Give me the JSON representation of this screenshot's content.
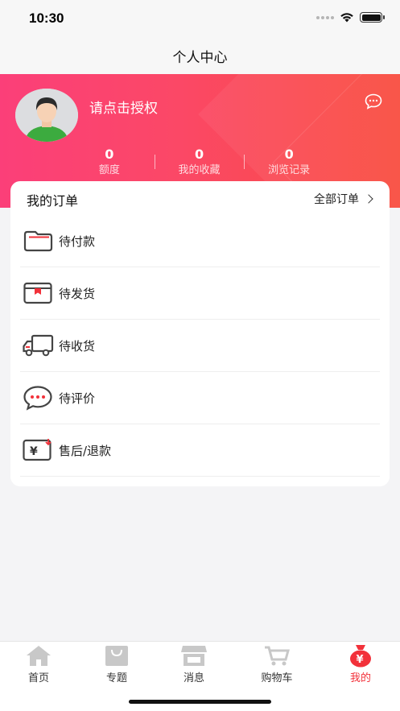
{
  "status_bar": {
    "time": "10:30"
  },
  "nav": {
    "title": "个人中心"
  },
  "profile": {
    "auth_prompt": "请点击授权",
    "stats": [
      {
        "value": "0",
        "label": "额度"
      },
      {
        "value": "0",
        "label": "我的收藏"
      },
      {
        "value": "0",
        "label": "浏览记录"
      }
    ]
  },
  "orders": {
    "title": "我的订单",
    "all_label": "全部订单",
    "items": [
      {
        "label": "待付款",
        "icon": "wallet-icon"
      },
      {
        "label": "待发货",
        "icon": "package-icon"
      },
      {
        "label": "待收货",
        "icon": "truck-icon"
      },
      {
        "label": "待评价",
        "icon": "comment-icon"
      },
      {
        "label": "售后/退款",
        "icon": "refund-icon"
      }
    ]
  },
  "tabs": [
    {
      "label": "首页",
      "icon": "home-icon"
    },
    {
      "label": "专题",
      "icon": "shopping-bag-icon"
    },
    {
      "label": "消息",
      "icon": "store-icon"
    },
    {
      "label": "购物车",
      "icon": "cart-icon"
    },
    {
      "label": "我的",
      "icon": "money-bag-icon",
      "active": true
    }
  ],
  "colors": {
    "header_gradient_start": "#fb3f79",
    "header_gradient_end": "#f94c3e",
    "active_tab": "#f2313a",
    "inactive_tab_icon": "#c8c8c8"
  }
}
